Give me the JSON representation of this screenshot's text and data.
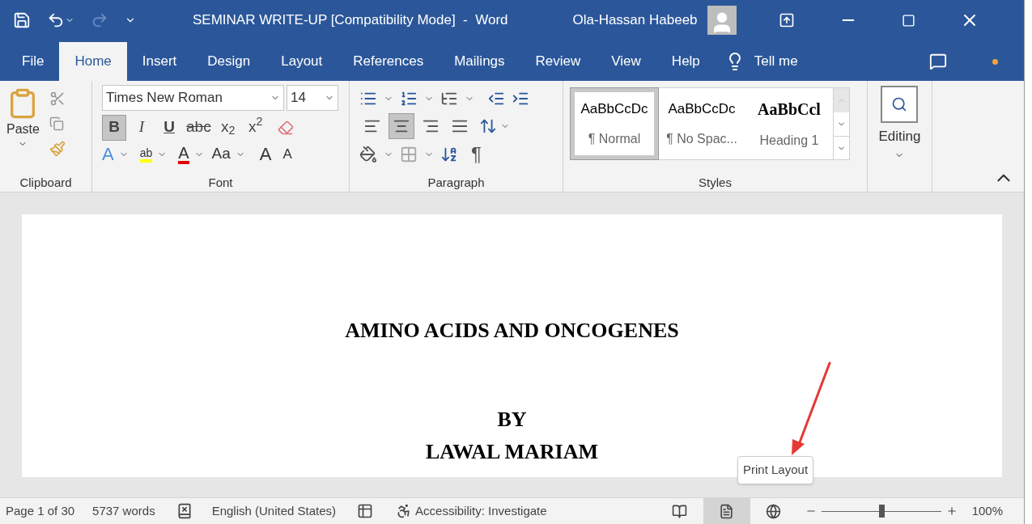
{
  "window": {
    "title": "SEMINAR WRITE-UP [Compatibility Mode]  -  Word",
    "user": "Ola-Hassan Habeeb"
  },
  "tabs": [
    {
      "label": "File",
      "selected": false
    },
    {
      "label": "Home",
      "selected": true
    },
    {
      "label": "Insert",
      "selected": false
    },
    {
      "label": "Design",
      "selected": false
    },
    {
      "label": "Layout",
      "selected": false
    },
    {
      "label": "References",
      "selected": false
    },
    {
      "label": "Mailings",
      "selected": false
    },
    {
      "label": "Review",
      "selected": false
    },
    {
      "label": "View",
      "selected": false
    },
    {
      "label": "Help",
      "selected": false
    }
  ],
  "tell_me": "Tell me",
  "clipboard": {
    "paste": "Paste",
    "label": "Clipboard"
  },
  "font": {
    "name": "Times New Roman",
    "size": "14",
    "label": "Font",
    "format_buttons": [
      {
        "kind": "bold",
        "label": "B",
        "pressed": true
      },
      {
        "kind": "italic",
        "label": "I",
        "pressed": false
      },
      {
        "kind": "underline",
        "label": "U",
        "pressed": false
      },
      {
        "kind": "strike",
        "label": "abc",
        "pressed": false
      },
      {
        "kind": "script",
        "label": "x$_{2}$",
        "pressed": false
      },
      {
        "kind": "script",
        "label": "x$^{2}$",
        "pressed": false
      }
    ],
    "effects": "A",
    "highlight": "ab",
    "font_color": "A",
    "case": "Aa",
    "grow": "A",
    "shrink": "A"
  },
  "paragraph": {
    "label": "Paragraph",
    "pilcrow": "¶",
    "alignments": [
      {
        "kind": "left",
        "selected": false
      },
      {
        "kind": "center",
        "selected": true
      },
      {
        "kind": "right",
        "selected": false
      },
      {
        "kind": "justify",
        "selected": false
      }
    ]
  },
  "styles": {
    "label": "Styles",
    "items": [
      {
        "preview": "AaBbCcDc",
        "name": "¶ Normal",
        "kind": "body",
        "selected": true
      },
      {
        "preview": "AaBbCcDc",
        "name": "¶ No Spac...",
        "kind": "body",
        "selected": false
      },
      {
        "preview": "AaBbCcl",
        "name": "Heading 1",
        "kind": "heading",
        "selected": false
      }
    ]
  },
  "editing": {
    "label": "Editing"
  },
  "document": {
    "lines": [
      "AMINO ACIDS AND ONCOGENES",
      "BY",
      "LAWAL MARIAM"
    ]
  },
  "tooltip": "Print Layout",
  "status_bar": {
    "page": "Page 1 of 30",
    "words": "5737 words",
    "language": "English (United States)",
    "accessibility": "Accessibility: Investigate",
    "views": [
      {
        "kind": "read",
        "selected": false
      },
      {
        "kind": "print",
        "selected": true
      },
      {
        "kind": "web",
        "selected": false
      }
    ],
    "zoom": {
      "level": 0.5,
      "reading": "100%"
    }
  }
}
